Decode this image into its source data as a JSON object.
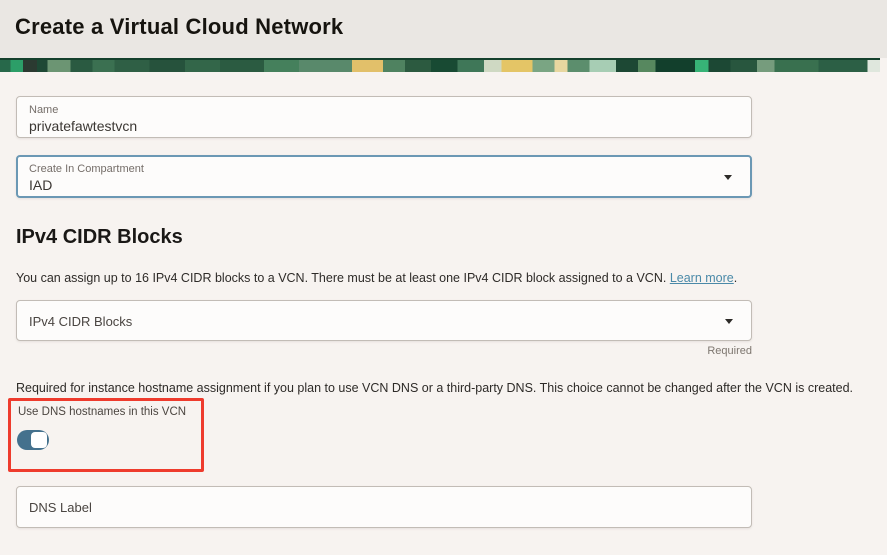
{
  "header": {
    "title": "Create a Virtual Cloud Network"
  },
  "form": {
    "name": {
      "label": "Name",
      "value": "privatefawtestvcn"
    },
    "compartment": {
      "label": "Create In Compartment",
      "value": "IAD",
      "state": "focused"
    },
    "ipv4_section": {
      "heading": "IPv4 CIDR Blocks",
      "description": "You can assign up to 16 IPv4 CIDR blocks to a VCN. There must be at least one IPv4 CIDR block assigned to a VCN. ",
      "learn_more": "Learn more",
      "period": ".",
      "dropdown_label": "IPv4 CIDR Blocks",
      "required_hint": "Required"
    },
    "dns_section": {
      "description": "Required for instance hostname assignment if you plan to use VCN DNS or a third-party DNS. This choice cannot be changed after the VCN is created.",
      "toggle_label": "Use DNS hostnames in this VCN",
      "toggle_state": "on",
      "dns_label_placeholder": "DNS Label"
    }
  },
  "icons": {
    "compartment_caret": "chevron-down-icon",
    "cidr_caret": "chevron-down-icon"
  },
  "colors": {
    "focus_border": "#6b98b4",
    "toggle_on": "#44718d",
    "annotation_red": "#ee3b2d",
    "link_blue": "#4a89a8"
  }
}
